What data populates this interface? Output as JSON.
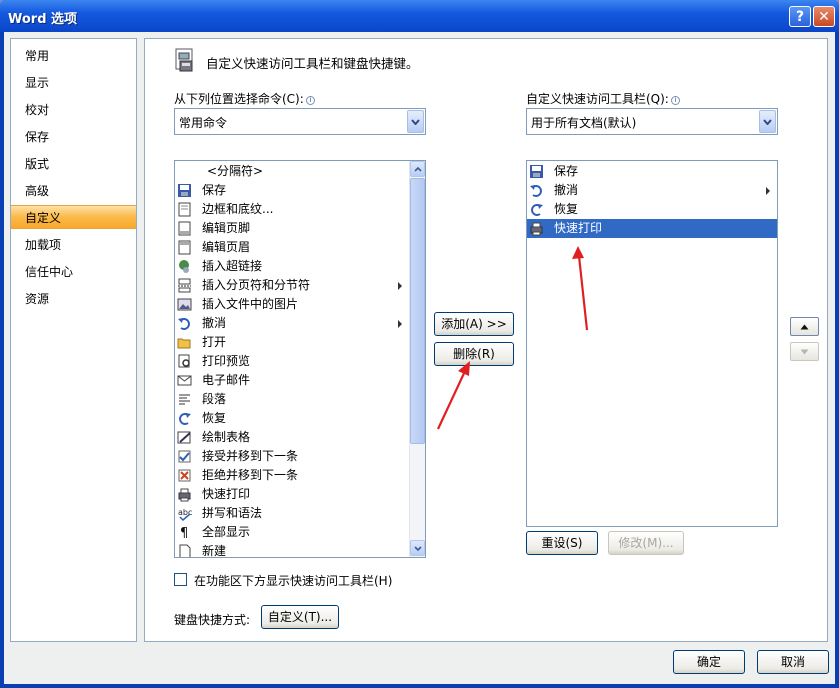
{
  "window": {
    "title": "Word 选项",
    "help_label": "?",
    "close_label": "✕"
  },
  "nav": {
    "items": [
      {
        "label": "常用"
      },
      {
        "label": "显示"
      },
      {
        "label": "校对"
      },
      {
        "label": "保存"
      },
      {
        "label": "版式"
      },
      {
        "label": "高级"
      },
      {
        "label": "自定义",
        "active": true
      },
      {
        "label": "加载项"
      },
      {
        "label": "信任中心"
      },
      {
        "label": "资源"
      }
    ]
  },
  "header": {
    "title": "自定义快速访问工具栏和键盘快捷键。"
  },
  "left": {
    "choose_label": "从下列位置选择命令(C):",
    "choose_value": "常用命令",
    "commands": [
      {
        "label": "<分隔符>",
        "icon": "separator"
      },
      {
        "label": "保存",
        "icon": "save-icon"
      },
      {
        "label": "边框和底纹...",
        "icon": "border-icon"
      },
      {
        "label": "编辑页脚",
        "icon": "footer-icon"
      },
      {
        "label": "编辑页眉",
        "icon": "header-icon"
      },
      {
        "label": "插入超链接",
        "icon": "hyperlink-icon"
      },
      {
        "label": "插入分页符和分节符",
        "icon": "page-break-icon",
        "submenu": true
      },
      {
        "label": "插入文件中的图片",
        "icon": "picture-icon"
      },
      {
        "label": "撤消",
        "icon": "undo-icon",
        "submenu": true
      },
      {
        "label": "打开",
        "icon": "open-folder-icon"
      },
      {
        "label": "打印预览",
        "icon": "print-preview-icon"
      },
      {
        "label": "电子邮件",
        "icon": "email-icon"
      },
      {
        "label": "段落",
        "icon": "paragraph-icon"
      },
      {
        "label": "恢复",
        "icon": "redo-icon"
      },
      {
        "label": "绘制表格",
        "icon": "draw-table-icon"
      },
      {
        "label": "接受并移到下一条",
        "icon": "accept-change-icon"
      },
      {
        "label": "拒绝并移到下一条",
        "icon": "reject-change-icon"
      },
      {
        "label": "快速打印",
        "icon": "quick-print-icon"
      },
      {
        "label": "拼写和语法",
        "icon": "spelling-icon"
      },
      {
        "label": "全部显示",
        "icon": "show-all-icon"
      },
      {
        "label": "新建",
        "icon": "new-document-icon"
      }
    ]
  },
  "right": {
    "toolbar_label": "自定义快速访问工具栏(Q):",
    "toolbar_value": "用于所有文档(默认)",
    "items": [
      {
        "label": "保存",
        "icon": "save-icon"
      },
      {
        "label": "撤消",
        "icon": "undo-icon",
        "submenu": true
      },
      {
        "label": "恢复",
        "icon": "redo-icon"
      },
      {
        "label": "快速打印",
        "icon": "quick-print-icon",
        "selected": true
      }
    ],
    "reset_label": "重设(S)",
    "modify_label": "修改(M)..."
  },
  "middle": {
    "add_label": "添加(A) >>",
    "remove_label": "删除(R)"
  },
  "bottom": {
    "show_below_label": "在功能区下方显示快速访问工具栏(H)",
    "shortcut_label": "键盘快捷方式:",
    "customize_label": "自定义(T)..."
  },
  "footer": {
    "ok_label": "确定",
    "cancel_label": "取消"
  },
  "colors": {
    "selection": "#316ac5",
    "active_nav": "#fbb949",
    "arrow": "#e02020"
  }
}
